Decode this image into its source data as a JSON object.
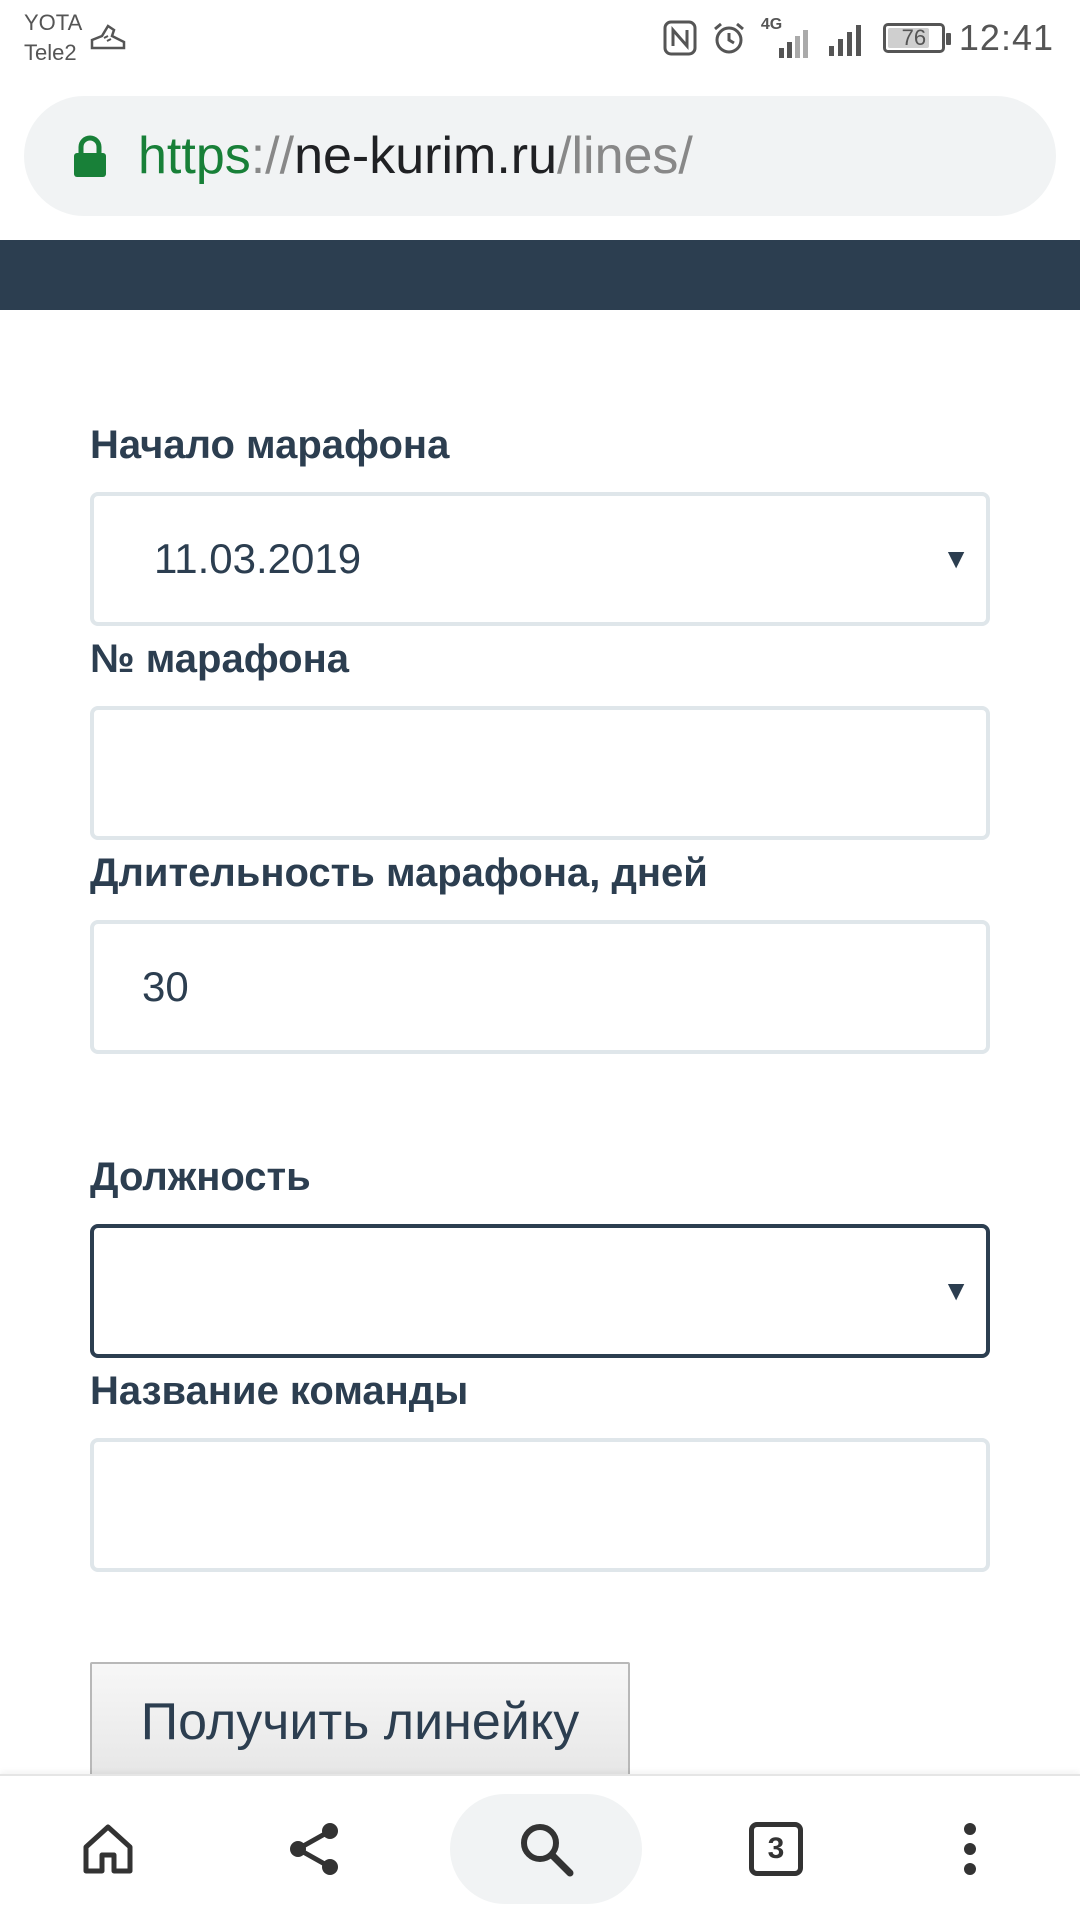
{
  "status_bar": {
    "carrier_1": "YOTA",
    "carrier_2": "Tele2",
    "network_type": "4G",
    "battery_level": "76",
    "battery_fraction": 0.76,
    "time": "12:41",
    "icons": [
      "running-shoe-icon",
      "nfc-icon",
      "alarm-icon",
      "signal-4g-icon",
      "signal-icon",
      "battery-icon"
    ]
  },
  "browser": {
    "url_scheme": "https",
    "url_sep": "://",
    "url_host": "ne-kurim.ru",
    "url_path": "/lines/",
    "toolbar": {
      "icons": [
        "home-icon",
        "share-icon",
        "search-icon",
        "tabs-icon",
        "more-icon"
      ],
      "tabs_count": "3"
    }
  },
  "colors": {
    "accent": "#2c3e50",
    "url_green": "#188038",
    "field_border": "#dfe6ea"
  },
  "form": {
    "start_label": "Начало марафона",
    "start_value": "11.03.2019",
    "number_label": "№ марафона",
    "number_value": "",
    "duration_label": "Длительность марафона, дней",
    "duration_value": "30",
    "position_label": "Должность",
    "position_value": "",
    "team_label": "Название команды",
    "team_value": "",
    "submit_label": "Получить линейку"
  }
}
